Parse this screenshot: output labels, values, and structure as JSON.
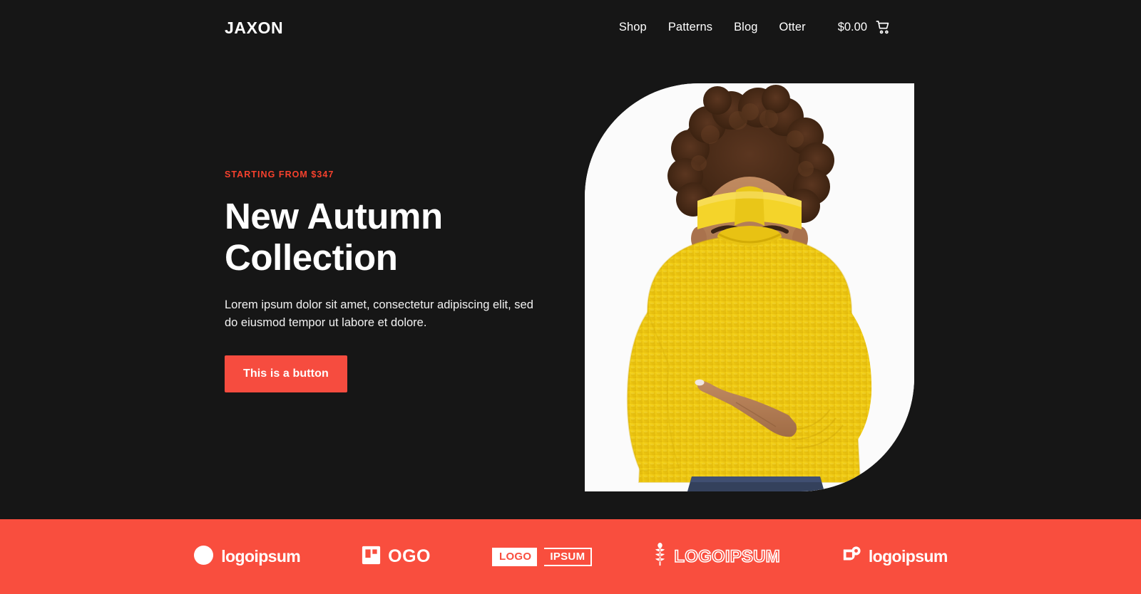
{
  "header": {
    "brand": "JAXON",
    "nav": [
      {
        "label": "Shop",
        "name": "nav-link-shop"
      },
      {
        "label": "Patterns",
        "name": "nav-link-patterns"
      },
      {
        "label": "Blog",
        "name": "nav-link-blog"
      },
      {
        "label": "Otter",
        "name": "nav-link-otter"
      }
    ],
    "cart_total": "$0.00",
    "cart_icon": "shopping-cart-icon"
  },
  "hero": {
    "eyebrow": "STARTING FROM $347",
    "title_line1": "New Autumn",
    "title_line2": "Collection",
    "subtitle": "Lorem ipsum dolor sit amet, consectetur adipiscing elit, sed do eiusmod tempor ut labore et dolore.",
    "button_label": "This is a button",
    "image_alt": "Smiling woman in yellow knit sweater and yellow headband pointing to the side"
  },
  "logo_band": {
    "logos": [
      {
        "name": "logo-split-circle",
        "text": "logoipsum",
        "style": "lowercase-mark"
      },
      {
        "name": "logo-square-l",
        "text": "OGO",
        "style": "uppercase-mark"
      },
      {
        "name": "logo-badge-pair",
        "text_left": "LOGO",
        "text_right": "IPSUM",
        "style": "badge"
      },
      {
        "name": "logo-wheat",
        "text": "LOGOIPSUM",
        "style": "outline-mark"
      },
      {
        "name": "logo-square-circle",
        "text": "logoipsum",
        "style": "lowercase-mark"
      }
    ]
  },
  "colors": {
    "background": "#161616",
    "accent_red": "#f94e3e",
    "eyebrow_red": "#f6412d",
    "text_white": "#ffffff",
    "image_backdrop": "#fbfbfb",
    "sweater_yellow": "#f2cd1d",
    "skin": "#b07a53",
    "hair": "#4a2d1c"
  }
}
